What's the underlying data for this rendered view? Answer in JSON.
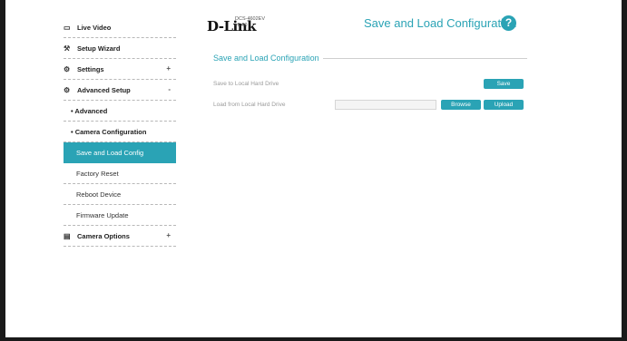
{
  "sidebar": {
    "items": [
      {
        "icon": "video-icon",
        "glyph": "▭",
        "label": "Live Video",
        "sign": ""
      },
      {
        "icon": "wizard-icon",
        "glyph": "⚒",
        "label": "Setup Wizard",
        "sign": ""
      },
      {
        "icon": "gear-icon",
        "glyph": "⚙",
        "label": "Settings",
        "sign": "+"
      },
      {
        "icon": "advanced-gear-icon",
        "glyph": "⚙",
        "label": "Advanced Setup",
        "sign": "-"
      },
      {
        "label": "• Advanced"
      },
      {
        "label": "• Camera Configuration"
      },
      {
        "label": "Save and Load Config"
      },
      {
        "label": "Factory Reset"
      },
      {
        "label": "Reboot Device"
      },
      {
        "label": "Firmware Update"
      },
      {
        "icon": "document-icon",
        "glyph": "▤",
        "label": "Camera Options",
        "sign": "+"
      }
    ]
  },
  "header": {
    "logo": "D-Link",
    "model": "DCS-4602EV",
    "version": "v2.00",
    "title": "Save and Load Configuration",
    "help": "?"
  },
  "main": {
    "section_title": "Save and Load Configuration",
    "save_row_label": "Save to Local Hard Drive",
    "save_button": "Save",
    "load_row_label": "Load from Local Hard Drive",
    "file_value": "",
    "browse_button": "Browse",
    "upload_button": "Upload"
  },
  "colors": {
    "accent": "#2aa3b5",
    "frame": "#1a1a1a"
  }
}
